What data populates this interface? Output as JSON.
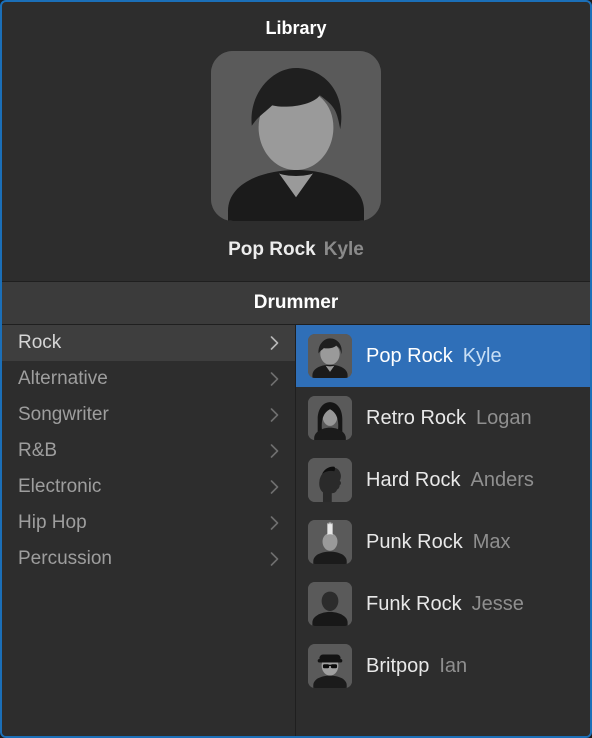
{
  "header": {
    "title": "Library"
  },
  "preview": {
    "style": "Pop Rock",
    "name": "Kyle"
  },
  "section": {
    "title": "Drummer"
  },
  "genres": [
    {
      "label": "Rock",
      "selected": true
    },
    {
      "label": "Alternative",
      "selected": false
    },
    {
      "label": "Songwriter",
      "selected": false
    },
    {
      "label": "R&B",
      "selected": false
    },
    {
      "label": "Electronic",
      "selected": false
    },
    {
      "label": "Hip Hop",
      "selected": false
    },
    {
      "label": "Percussion",
      "selected": false
    }
  ],
  "drummers": [
    {
      "style": "Pop Rock",
      "name": "Kyle",
      "selected": true,
      "avatar": "kyle"
    },
    {
      "style": "Retro Rock",
      "name": "Logan",
      "selected": false,
      "avatar": "logan"
    },
    {
      "style": "Hard Rock",
      "name": "Anders",
      "selected": false,
      "avatar": "anders"
    },
    {
      "style": "Punk Rock",
      "name": "Max",
      "selected": false,
      "avatar": "max"
    },
    {
      "style": "Funk Rock",
      "name": "Jesse",
      "selected": false,
      "avatar": "jesse"
    },
    {
      "style": "Britpop",
      "name": "Ian",
      "selected": false,
      "avatar": "ian"
    }
  ]
}
